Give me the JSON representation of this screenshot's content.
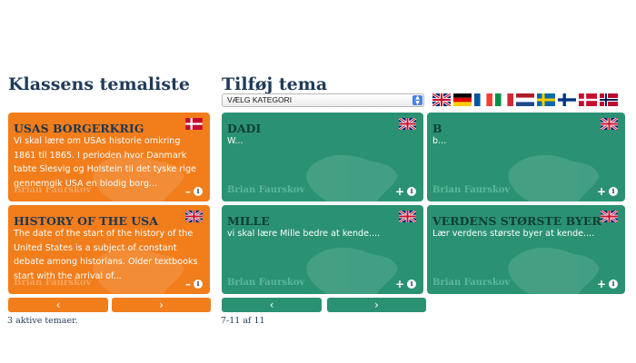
{
  "left_panel": {
    "heading": "Klassens temaliste",
    "cards": [
      {
        "title": "USAS BORGERKRIG",
        "flag": "danish-flag-icon",
        "description": "Vi skal lære om USAs historie omkring 1861 til 1865. I perioden hvor Danmark tabte Slesvig og Holstein til det tyske rige gennemgik USA en blodig borg...",
        "author": "Brian Faurskov",
        "action_symbol": "–",
        "info_symbol": "i"
      },
      {
        "title": "HISTORY OF THE USA",
        "flag": "uk-flag-icon",
        "description": "The date of the start of the history of the United States is a subject of constant debate among historians. Older textbooks start with the arrival of...",
        "author": "Brian Faurskov",
        "action_symbol": "–",
        "info_symbol": "i"
      }
    ],
    "prev_label": "‹",
    "next_label": "›",
    "status": "3 aktive temaer."
  },
  "right_panel": {
    "heading": "Tilføj tema",
    "category_select": {
      "value": "VÆLG KATEGORI",
      "icon": "select-arrows-icon"
    },
    "language_flags": [
      "uk",
      "germany",
      "france",
      "italy",
      "netherlands",
      "sweden",
      "finland",
      "denmark",
      "norway"
    ],
    "cards": [
      {
        "title": "DADI",
        "flag": "uk-flag-icon",
        "description": "W...",
        "author": "Brian Faurskov",
        "action_symbol": "+",
        "info_symbol": "i"
      },
      {
        "title": "B",
        "flag": "uk-flag-icon",
        "description": "b...",
        "author": "Brian Faurskov",
        "action_symbol": "+",
        "info_symbol": "i"
      },
      {
        "title": "MILLE",
        "flag": "uk-flag-icon",
        "description": "vi skal lære Mille bedre at kende....",
        "author": "Brian Faurskov",
        "action_symbol": "+",
        "info_symbol": "i"
      },
      {
        "title": "VERDENS STØRSTE BYER",
        "flag": "uk-flag-icon",
        "description": "Lær verdens største byer at kende....",
        "author": "Brian Faurskov",
        "action_symbol": "+",
        "info_symbol": "i"
      }
    ],
    "prev_label": "‹",
    "next_label": "›",
    "pagination": "7-11 af 11"
  },
  "colors": {
    "orange": "#f27d1b",
    "green": "#2a9272",
    "heading": "#1f3b5a"
  }
}
